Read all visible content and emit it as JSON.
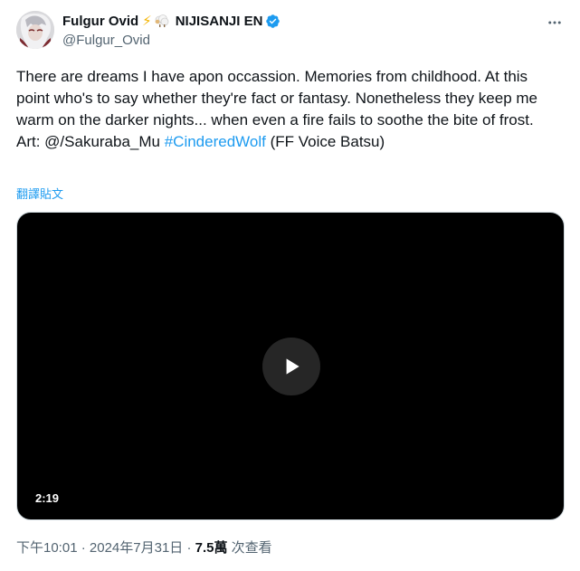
{
  "author": {
    "display_name": "Fulgur Ovid",
    "emoji_bolt": "⚡",
    "affiliation": "NIJISANJI EN",
    "handle": "@Fulgur_Ovid",
    "verified_icon": "verified-badge-icon"
  },
  "tweet": {
    "paragraph": "There are dreams I have apon occassion. Memories from childhood. At this point who's to say whether they're fact or fantasy. Nonetheless they keep me warm on the darker nights... when even a fire fails to soothe the bite of frost.",
    "art_prefix": "Art: @/Sakuraba_Mu ",
    "hashtag": "#CinderedWolf",
    "art_suffix": " (FF Voice Batsu)",
    "translate_label": "翻譯貼文"
  },
  "video": {
    "duration": "2:19",
    "play_icon": "play-icon"
  },
  "meta": {
    "time": "下午10:01",
    "separator": " · ",
    "date": "2024年7月31日",
    "views_count": "7.5萬",
    "views_label": " 次查看"
  },
  "colors": {
    "link": "#1d9bf0",
    "text": "#0f1419",
    "muted": "#536471",
    "verified": "#1d9bf0"
  }
}
